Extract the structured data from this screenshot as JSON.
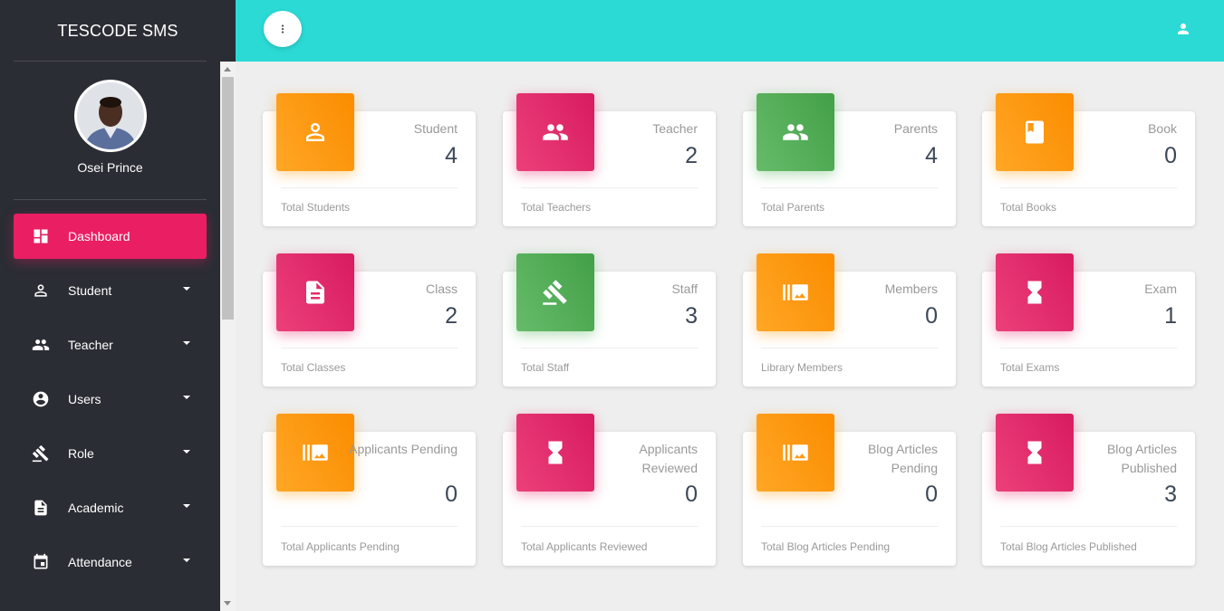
{
  "brand": "TESCODE SMS",
  "profile": {
    "name": "Osei Prince"
  },
  "nav": [
    {
      "label": "Dashboard",
      "icon": "dashboard-icon",
      "active": true
    },
    {
      "label": "Student",
      "icon": "person-icon"
    },
    {
      "label": "Teacher",
      "icon": "people-icon"
    },
    {
      "label": "Users",
      "icon": "account-circle-icon"
    },
    {
      "label": "Role",
      "icon": "gavel-icon"
    },
    {
      "label": "Academic",
      "icon": "document-icon"
    },
    {
      "label": "Attendance",
      "icon": "calendar-icon"
    }
  ],
  "colors": {
    "sidebar": "#2b2d34",
    "topbar": "#2cdad5",
    "active": "#e91e63",
    "orange": "#fb8c00",
    "pink": "#d81b60",
    "green": "#43a047"
  },
  "cards": [
    {
      "category": "Student",
      "value": "4",
      "footer": "Total Students",
      "icon": "person-icon",
      "color": "orange"
    },
    {
      "category": "Teacher",
      "value": "2",
      "footer": "Total Teachers",
      "icon": "people-icon",
      "color": "pink"
    },
    {
      "category": "Parents",
      "value": "4",
      "footer": "Total Parents",
      "icon": "people-icon",
      "color": "green"
    },
    {
      "category": "Book",
      "value": "0",
      "footer": "Total Books",
      "icon": "book-icon",
      "color": "orange"
    },
    {
      "category": "Class",
      "value": "2",
      "footer": "Total Classes",
      "icon": "document-icon",
      "color": "pink"
    },
    {
      "category": "Staff",
      "value": "3",
      "footer": "Total Staff",
      "icon": "gavel-icon",
      "color": "green"
    },
    {
      "category": "Members",
      "value": "0",
      "footer": "Library Members",
      "icon": "photo-library-icon",
      "color": "orange"
    },
    {
      "category": "Exam",
      "value": "1",
      "footer": "Total Exams",
      "icon": "hourglass-icon",
      "color": "pink"
    },
    {
      "category": "Applicants Pending",
      "value": "0",
      "footer": "Total Applicants Pending",
      "icon": "photo-library-icon",
      "color": "orange"
    },
    {
      "category": "Applicants Reviewed",
      "value": "0",
      "footer": "Total Applicants Reviewed",
      "icon": "hourglass-icon",
      "color": "pink"
    },
    {
      "category": "Blog Articles Pending",
      "value": "0",
      "footer": "Total Blog Articles Pending",
      "icon": "photo-library-icon",
      "color": "orange"
    },
    {
      "category": "Blog Articles Published",
      "value": "3",
      "footer": "Total Blog Articles Published",
      "icon": "hourglass-icon",
      "color": "pink"
    }
  ]
}
